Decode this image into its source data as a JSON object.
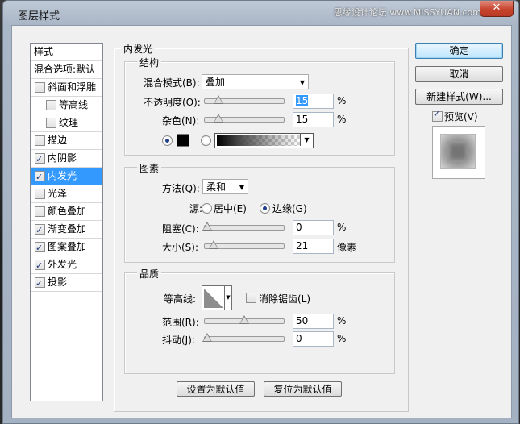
{
  "window": {
    "title": "图层样式",
    "watermark": "思缘设计论坛 www.MISSYUAN.com",
    "close_glyph": "✕"
  },
  "style_list": {
    "header": "样式",
    "blend_item": "混合选项:默认",
    "items": [
      {
        "label": "斜面和浮雕",
        "checked": false,
        "indent": false
      },
      {
        "label": "等高线",
        "checked": false,
        "indent": true
      },
      {
        "label": "纹理",
        "checked": false,
        "indent": true
      },
      {
        "label": "描边",
        "checked": false,
        "indent": false
      },
      {
        "label": "内阴影",
        "checked": true,
        "indent": false
      },
      {
        "label": "内发光",
        "checked": true,
        "indent": false,
        "selected": true
      },
      {
        "label": "光泽",
        "checked": false,
        "indent": false
      },
      {
        "label": "颜色叠加",
        "checked": false,
        "indent": false
      },
      {
        "label": "渐变叠加",
        "checked": true,
        "indent": false
      },
      {
        "label": "图案叠加",
        "checked": true,
        "indent": false
      },
      {
        "label": "外发光",
        "checked": true,
        "indent": false
      },
      {
        "label": "投影",
        "checked": true,
        "indent": false
      }
    ]
  },
  "inner_glow": {
    "title": "内发光",
    "structure": {
      "title": "结构",
      "blend_mode_label": "混合模式(B):",
      "blend_mode_value": "叠加",
      "opacity_label": "不透明度(O):",
      "opacity_value": "15",
      "opacity_unit": "%",
      "noise_label": "杂色(N):",
      "noise_value": "15",
      "noise_unit": "%"
    },
    "elements": {
      "title": "图素",
      "technique_label": "方法(Q):",
      "technique_value": "柔和",
      "source_label": "源:",
      "source_center": "居中(E)",
      "source_edge": "边缘(G)",
      "choke_label": "阻塞(C):",
      "choke_value": "0",
      "choke_unit": "%",
      "size_label": "大小(S):",
      "size_value": "21",
      "size_unit": "像素"
    },
    "quality": {
      "title": "品质",
      "contour_label": "等高线:",
      "anti_alias_label": "消除锯齿(L)",
      "range_label": "范围(R):",
      "range_value": "50",
      "range_unit": "%",
      "jitter_label": "抖动(J):",
      "jitter_value": "0",
      "jitter_unit": "%"
    },
    "make_default": "设置为默认值",
    "reset_default": "复位为默认值"
  },
  "slider_levels": {
    "opacity": 0.15,
    "noise": 0.15,
    "choke": 0.0,
    "size": 0.084,
    "range": 0.5,
    "jitter": 0.0
  },
  "buttons": {
    "ok": "确定",
    "cancel": "取消",
    "new_style": "新建样式(W)...",
    "preview_label": "预览(V)"
  },
  "colors": {
    "selection": "#3399ff",
    "glow_color": "#000000"
  }
}
